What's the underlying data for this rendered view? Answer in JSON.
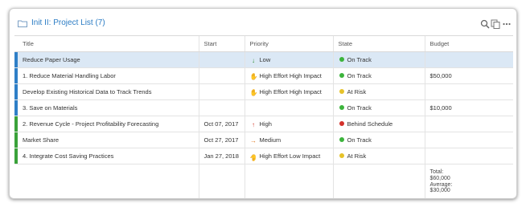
{
  "header": {
    "title": "Init II: Project List (7)",
    "icons": [
      "folder-icon",
      "search-icon",
      "copy-icon",
      "more-icon"
    ]
  },
  "table": {
    "columns": [
      "Title",
      "Start",
      "Priority",
      "State",
      "Budget"
    ],
    "rows": [
      {
        "title": "Reduce Paper Usage",
        "start": "",
        "priority": "Low",
        "state": "On Track",
        "budget": "",
        "accent": "#2f7fc7",
        "priority_icon": "arrow-down-icon",
        "priority_color": "#2e8b2e",
        "state_color": "#3cb43c",
        "selected": true
      },
      {
        "title": "1. Reduce Material Handling Labor",
        "start": "",
        "priority": "High Effort High Impact",
        "state": "On Track",
        "budget": "$50,000",
        "accent": "#2f7fc7",
        "priority_icon": "thumbs-up-icon",
        "priority_color": "#e07b26",
        "state_color": "#3cb43c",
        "selected": false
      },
      {
        "title": "Develop Existing Historical Data to Track Trends",
        "start": "",
        "priority": "High Effort High Impact",
        "state": "At Risk",
        "budget": "",
        "accent": "#2f7fc7",
        "priority_icon": "thumbs-up-icon",
        "priority_color": "#e07b26",
        "state_color": "#e6c229",
        "selected": false
      },
      {
        "title": "3. Save on Materials",
        "start": "",
        "priority": "",
        "state": "On Track",
        "budget": "$10,000",
        "accent": "#2f7fc7",
        "priority_icon": "",
        "priority_color": "",
        "state_color": "#3cb43c",
        "selected": false
      },
      {
        "title": "2. Revenue Cycle - Project Profitability Forecasting",
        "start": "Oct 07, 2017",
        "priority": "High",
        "state": "Behind Schedule",
        "budget": "",
        "accent": "#3aa23a",
        "priority_icon": "arrow-up-icon",
        "priority_color": "#d23a2a",
        "state_color": "#d3302a",
        "selected": false
      },
      {
        "title": "Market Share",
        "start": "Oct 27, 2017",
        "priority": "Medium",
        "state": "On Track",
        "budget": "",
        "accent": "#3aa23a",
        "priority_icon": "arrow-right-icon",
        "priority_color": "#e07b26",
        "state_color": "#3cb43c",
        "selected": false
      },
      {
        "title": "4. Integrate Cost Saving Practices",
        "start": "Jan 27, 2018",
        "priority": "High Effort Low Impact",
        "state": "At Risk",
        "budget": "",
        "accent": "#3aa23a",
        "priority_icon": "thumbs-down-icon",
        "priority_color": "#d23a2a",
        "state_color": "#e6c229",
        "selected": false
      }
    ],
    "totals": {
      "total_label": "Total:",
      "total_value": "$60,000",
      "average_label": "Average:",
      "average_value": "$30,000"
    }
  }
}
